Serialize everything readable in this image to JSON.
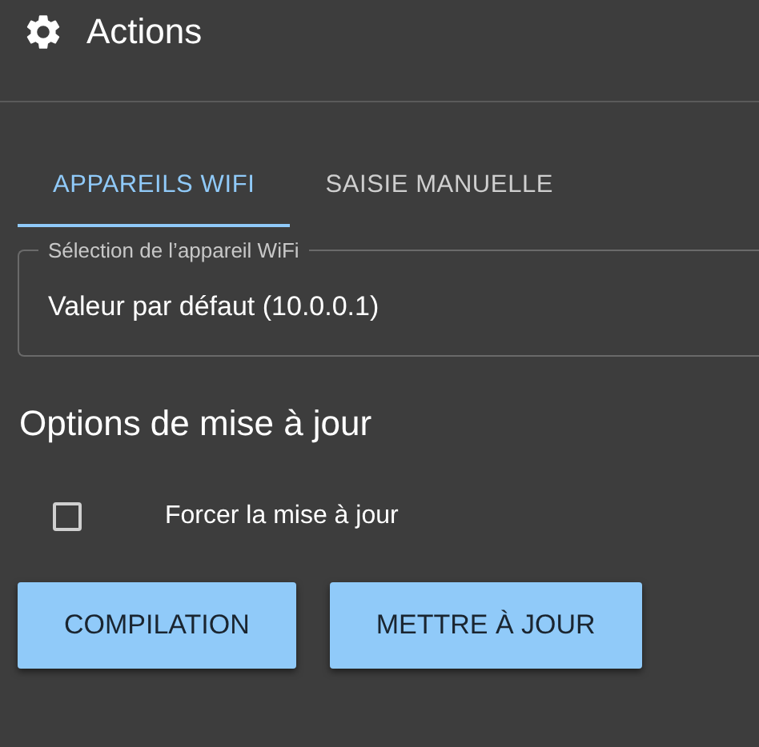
{
  "header": {
    "title": "Actions"
  },
  "tabs": [
    {
      "label": "APPAREILS WIFI",
      "selected": true
    },
    {
      "label": "SAISIE MANUELLE",
      "selected": false
    }
  ],
  "device_select": {
    "label": "Sélection de l’appareil WiFi",
    "value": "Valeur par défaut (10.0.0.1)"
  },
  "options": {
    "title": "Options de mise à jour",
    "checkboxes": [
      {
        "label": "Forcer la mise à jour",
        "checked": false
      }
    ]
  },
  "buttons": [
    "COMPILATION",
    "METTRE À JOUR"
  ]
}
